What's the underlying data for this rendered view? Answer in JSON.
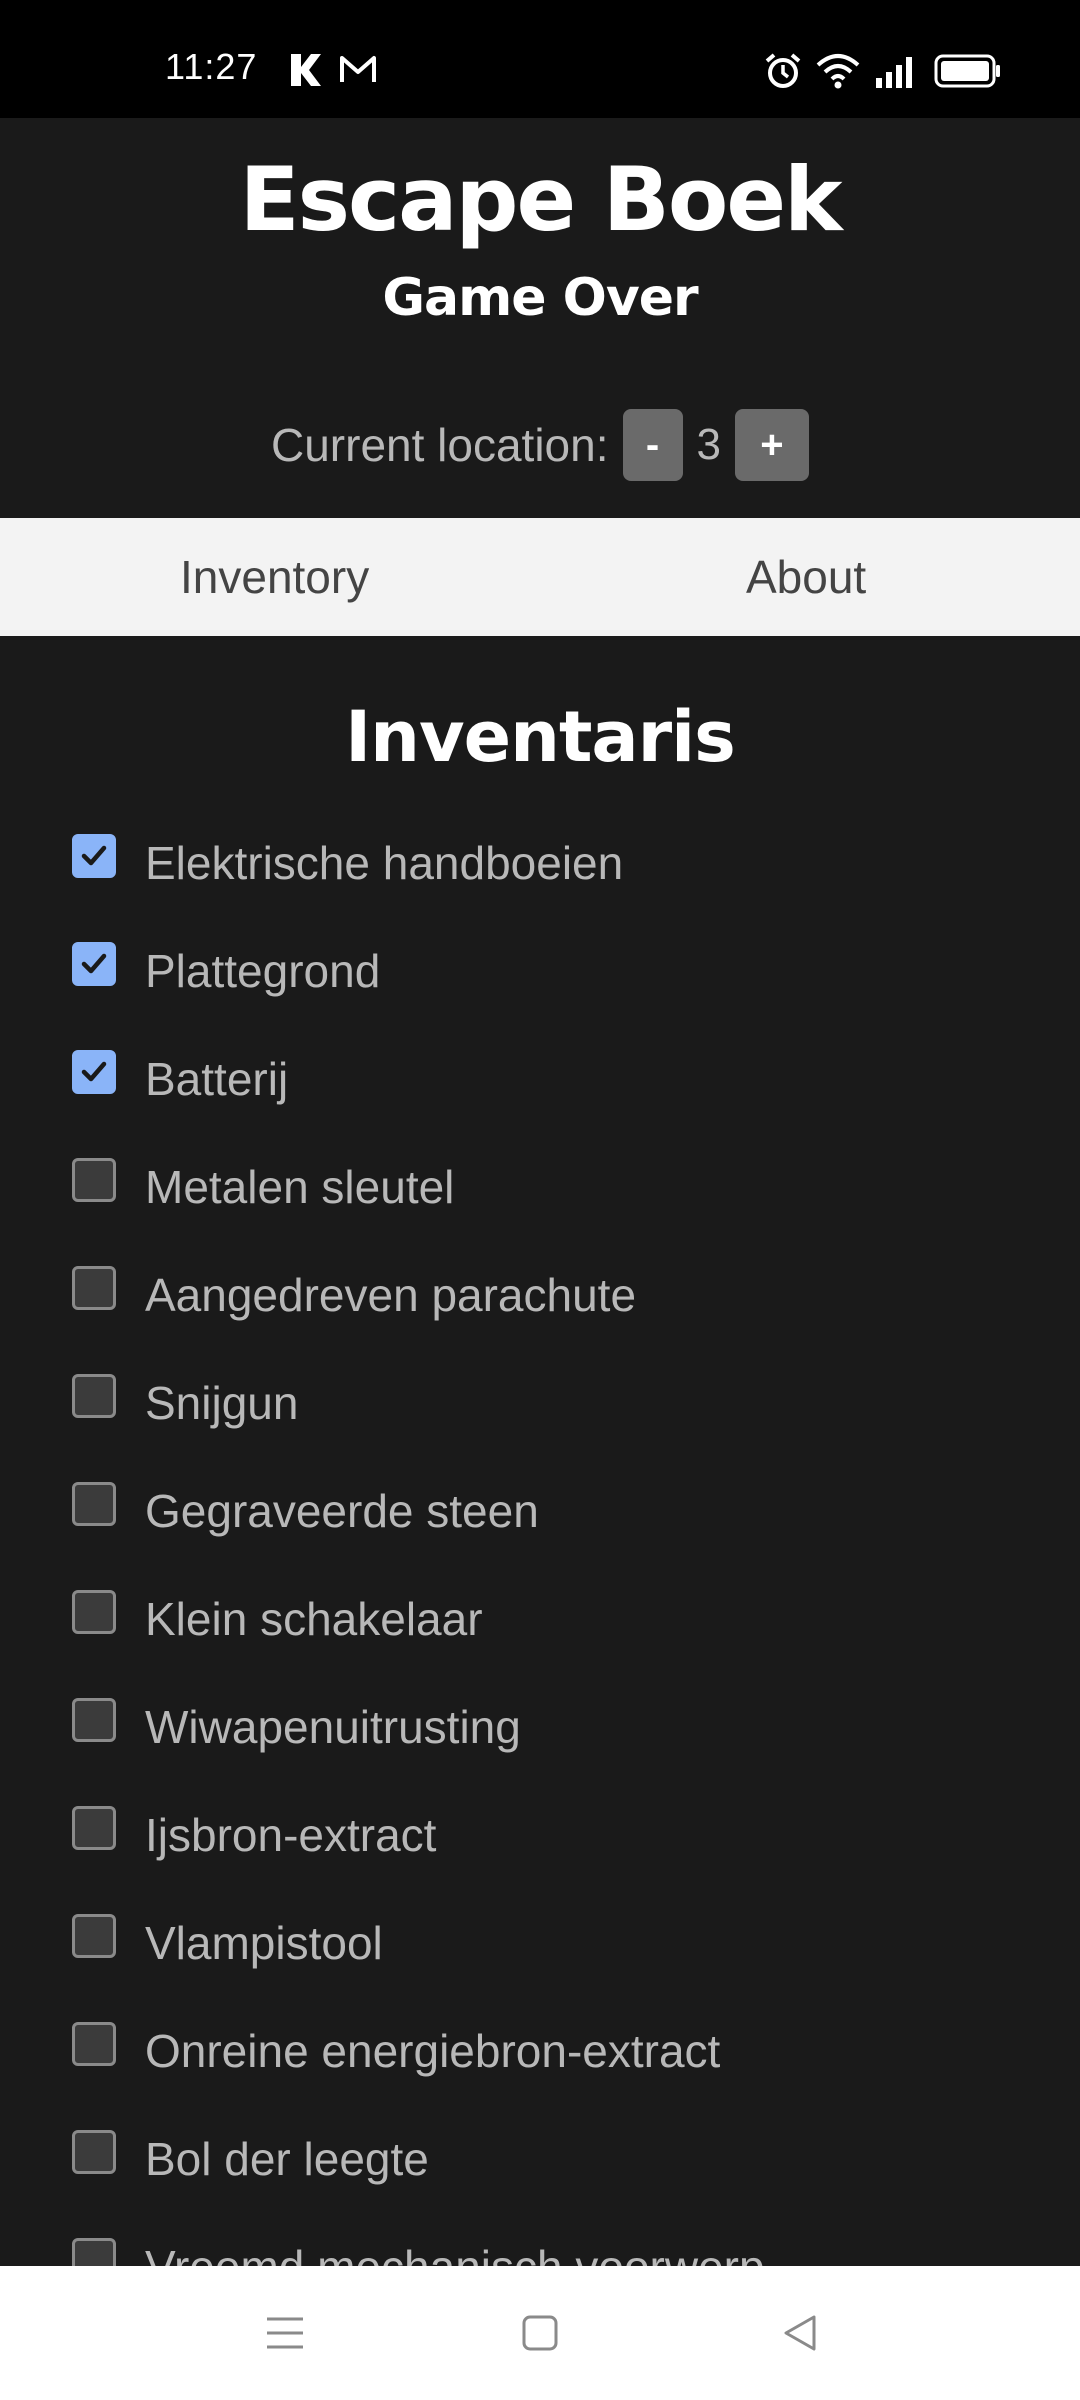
{
  "status_bar": {
    "time": "11:27",
    "icons": [
      "kasa-app-icon",
      "gmail-icon",
      "alarm-icon",
      "wifi-icon",
      "signal-icon",
      "battery-icon"
    ]
  },
  "header": {
    "title": "Escape Boek",
    "subtitle": "Game Over",
    "location_label": "Current location:",
    "decrement_label": "-",
    "location_value": "3",
    "increment_label": "+"
  },
  "tabs": [
    {
      "label": "Inventory"
    },
    {
      "label": "About"
    }
  ],
  "inventory": {
    "title": "Inventaris",
    "items": [
      {
        "label": "Elektrische handboeien",
        "checked": true
      },
      {
        "label": "Plattegrond",
        "checked": true
      },
      {
        "label": "Batterij",
        "checked": true
      },
      {
        "label": "Metalen sleutel",
        "checked": false
      },
      {
        "label": "Aangedreven parachute",
        "checked": false
      },
      {
        "label": "Snijgun",
        "checked": false
      },
      {
        "label": "Gegraveerde steen",
        "checked": false
      },
      {
        "label": "Klein schakelaar",
        "checked": false
      },
      {
        "label": "Wiwapenuitrusting",
        "checked": false
      },
      {
        "label": "Ijsbron-extract",
        "checked": false
      },
      {
        "label": "Vlampistool",
        "checked": false
      },
      {
        "label": "Onreine energiebron-extract",
        "checked": false
      },
      {
        "label": "Bol der leegte",
        "checked": false
      },
      {
        "label": "Vreemd mechanisch voorwerp",
        "checked": false
      }
    ]
  },
  "nav_bar": {
    "icons": [
      "menu-icon",
      "home-icon",
      "back-icon"
    ]
  },
  "colors": {
    "background": "#1a1a1a",
    "status_bar": "#000000",
    "tab_bar": "#f3f3f3",
    "checkbox_checked": "#8ab4f8",
    "button": "#6a6a6a"
  }
}
